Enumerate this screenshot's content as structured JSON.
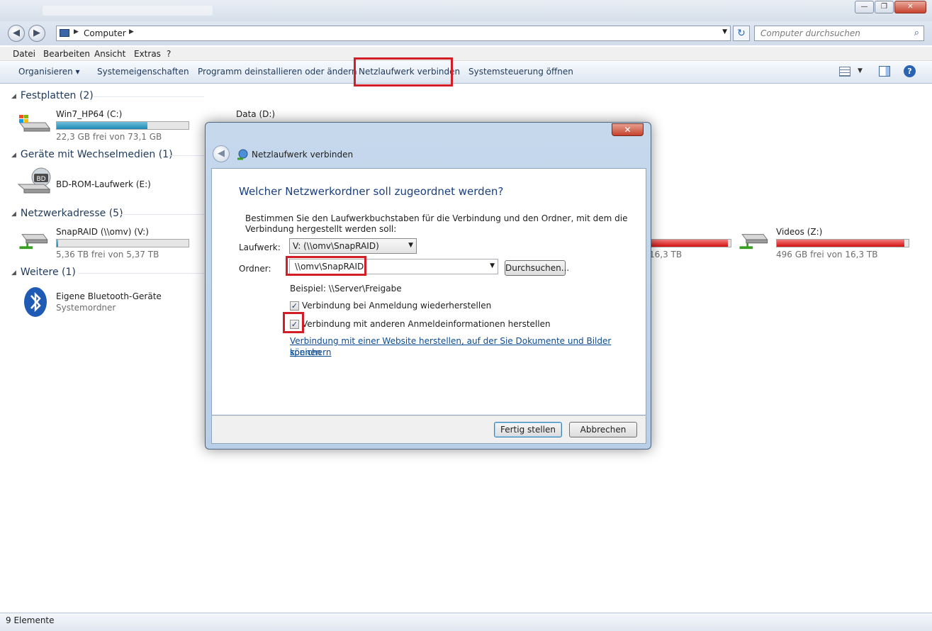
{
  "window": {
    "min": "—",
    "max": "❐",
    "close": "✕"
  },
  "address": {
    "path": "Computer",
    "search_placeholder": "Computer durchsuchen"
  },
  "menu": [
    "Datei",
    "Bearbeiten",
    "Ansicht",
    "Extras",
    "?"
  ],
  "commands": {
    "organize": "Organisieren ▾",
    "system_props": "Systemeigenschaften",
    "uninstall": "Programm deinstallieren oder ändern",
    "map_drive": "Netzlaufwerk verbinden",
    "control_panel": "Systemsteuerung öffnen"
  },
  "groups": {
    "hdd": "Festplatten (2)",
    "removable": "Geräte mit Wechselmedien (1)",
    "network": "Netzwerkadresse (5)",
    "other": "Weitere (1)"
  },
  "drives": {
    "c": {
      "name": "Win7_HP64 (C:)",
      "free": "22,3 GB frei von 73,1 GB",
      "used_fraction": 0.69
    },
    "d": {
      "name": "Data (D:)"
    },
    "bd": {
      "name": "BD-ROM-Laufwerk (E:)",
      "label": "BD"
    },
    "v": {
      "name": "SnapRAID (\\\\omv) (V:)",
      "free": "5,36 TB frei von 5,37 TB",
      "used_fraction": 0.01
    },
    "hidden": {
      "free": "16,3 TB",
      "used_fraction": 0.97
    },
    "z": {
      "name": "Videos (Z:)",
      "free": "496 GB frei von 16,3 TB",
      "used_fraction": 0.97
    },
    "bt": {
      "name": "Eigene Bluetooth-Geräte",
      "type": "Systemordner"
    }
  },
  "status": "9 Elemente",
  "dialog": {
    "title": "Netzlaufwerk verbinden",
    "heading": "Welcher Netzwerkordner soll zugeordnet werden?",
    "description": "Bestimmen Sie den Laufwerkbuchstaben für die Verbindung und den Ordner, mit dem die Verbindung hergestellt werden soll:",
    "drive_label": "Laufwerk:",
    "drive_value": "V: (\\\\omv\\SnapRAID)",
    "folder_label": "Ordner:",
    "folder_value": "\\\\omv\\SnapRAID",
    "browse": "Durchsuchen...",
    "example": "Beispiel: \\\\Server\\Freigabe",
    "reconnect": {
      "label": "Verbindung bei Anmeldung wiederherstellen",
      "checked": true
    },
    "other_creds": {
      "label": "Verbindung mit anderen Anmeldeinformationen herstellen",
      "checked": true
    },
    "link_line1": "Verbindung mit einer Website herstellen, auf der Sie Dokumente und Bilder speichern",
    "link_line2": "können",
    "finish": "Fertig stellen",
    "cancel": "Abbrechen",
    "check_glyph": "✓"
  },
  "colors": {
    "highlight": "#d21f27",
    "link": "#0a4b95",
    "heading": "#1a3e82"
  }
}
